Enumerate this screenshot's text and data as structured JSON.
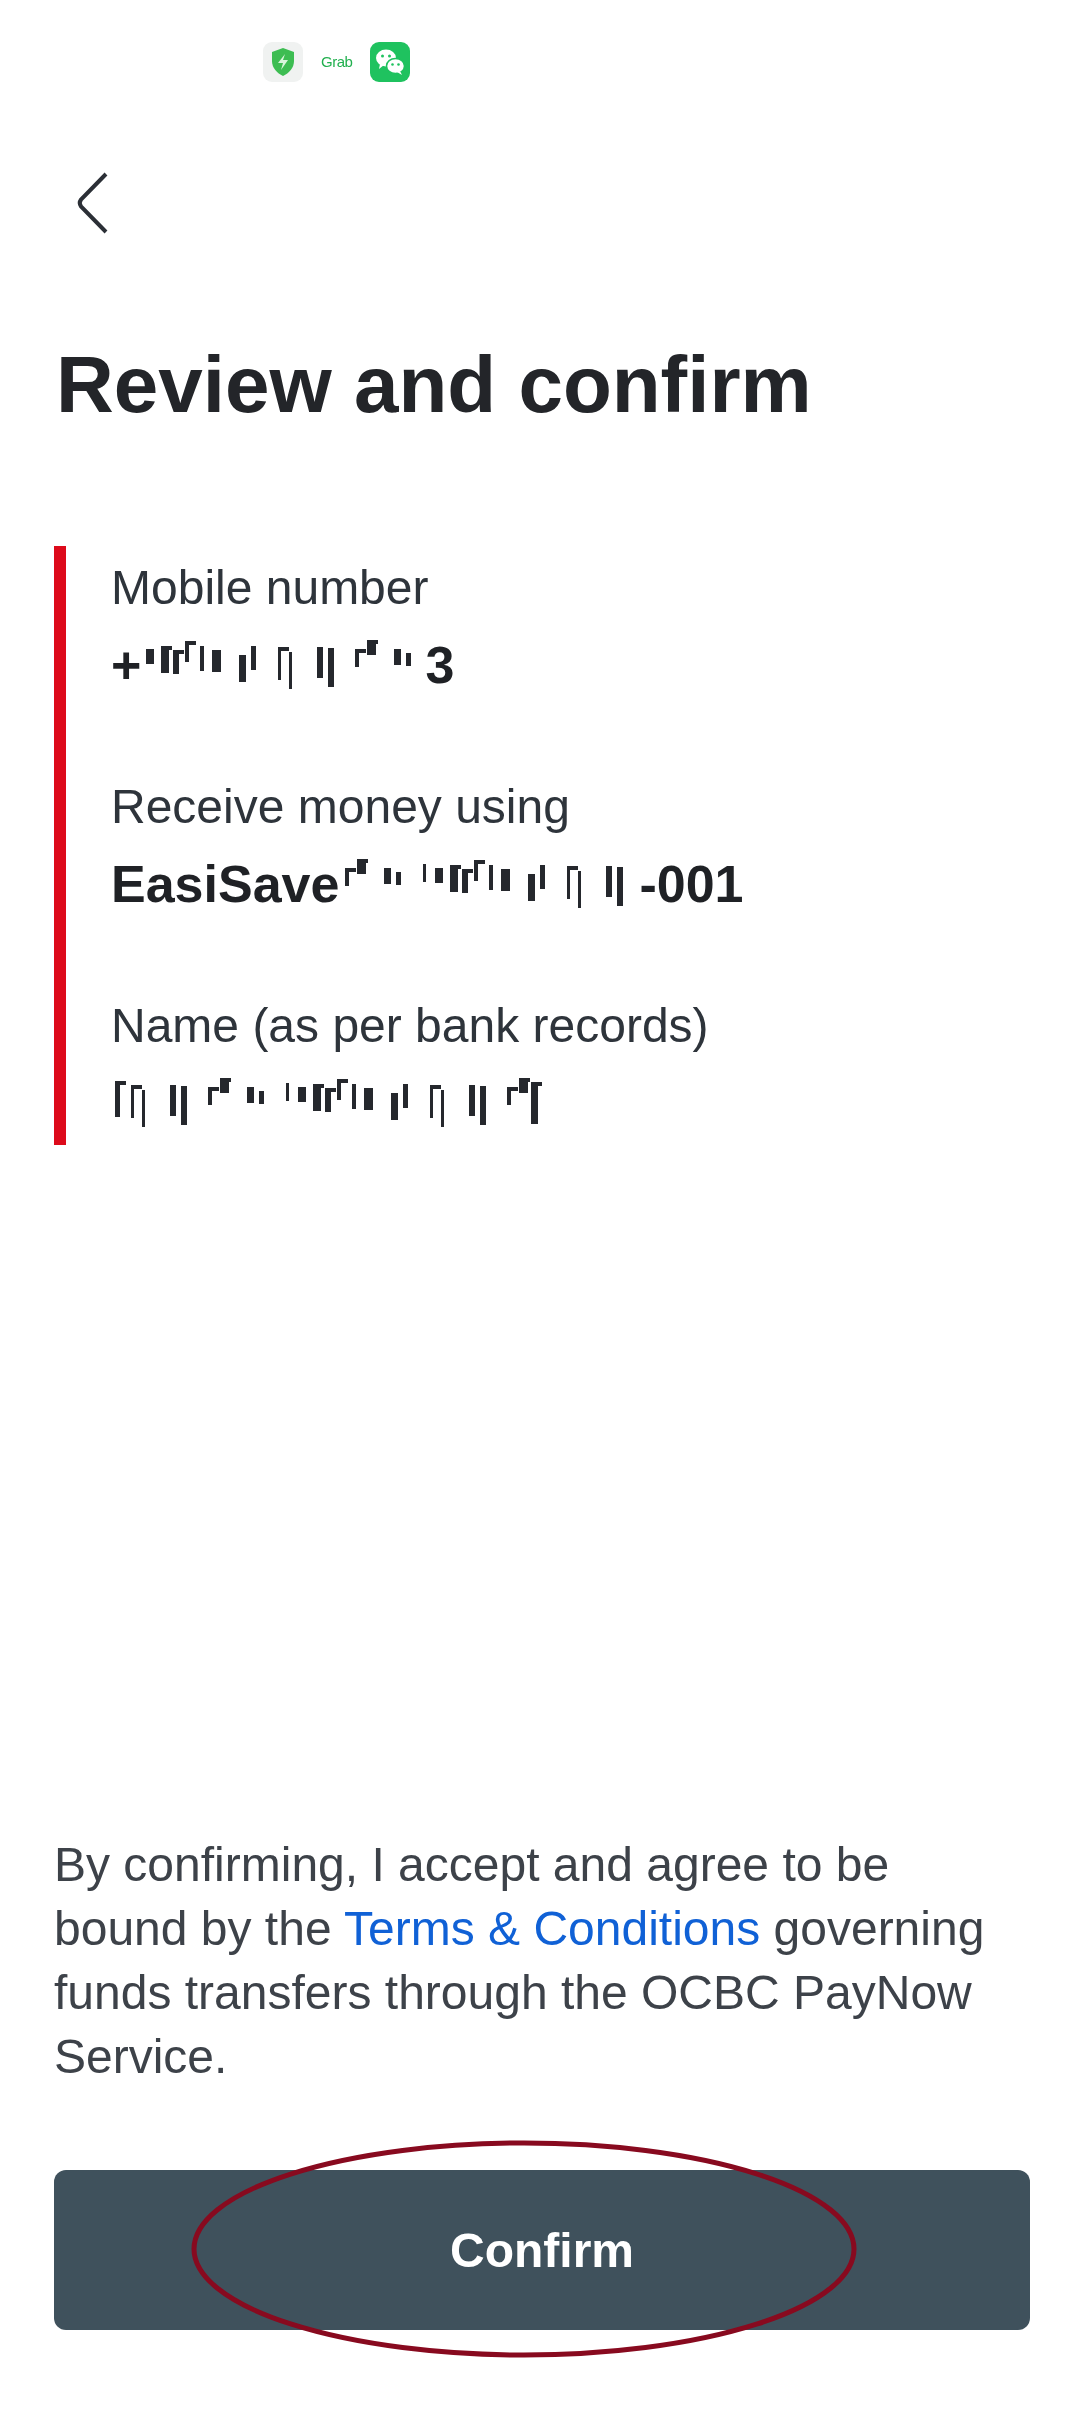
{
  "status_bar": {
    "icons": [
      {
        "kind": "shield"
      },
      {
        "kind": "logo",
        "text": "Grab"
      },
      {
        "kind": "chat"
      }
    ]
  },
  "title": "Review and confirm",
  "details": [
    {
      "label": "Mobile number",
      "value": "+",
      "value_end": "3",
      "redacted": true
    },
    {
      "label": "Receive money using",
      "value": "EasiSave",
      "value_end": "-001",
      "redacted": true
    },
    {
      "label": "Name (as per bank records)",
      "redacted": true
    }
  ],
  "terms": {
    "before": "By confirming, I accept and agree to be bound by the ",
    "link": "Terms & Conditions",
    "after": " governing funds transfers through the OCBC PayNow Service."
  },
  "confirm_button": {
    "label": "Confirm",
    "circled": true
  }
}
